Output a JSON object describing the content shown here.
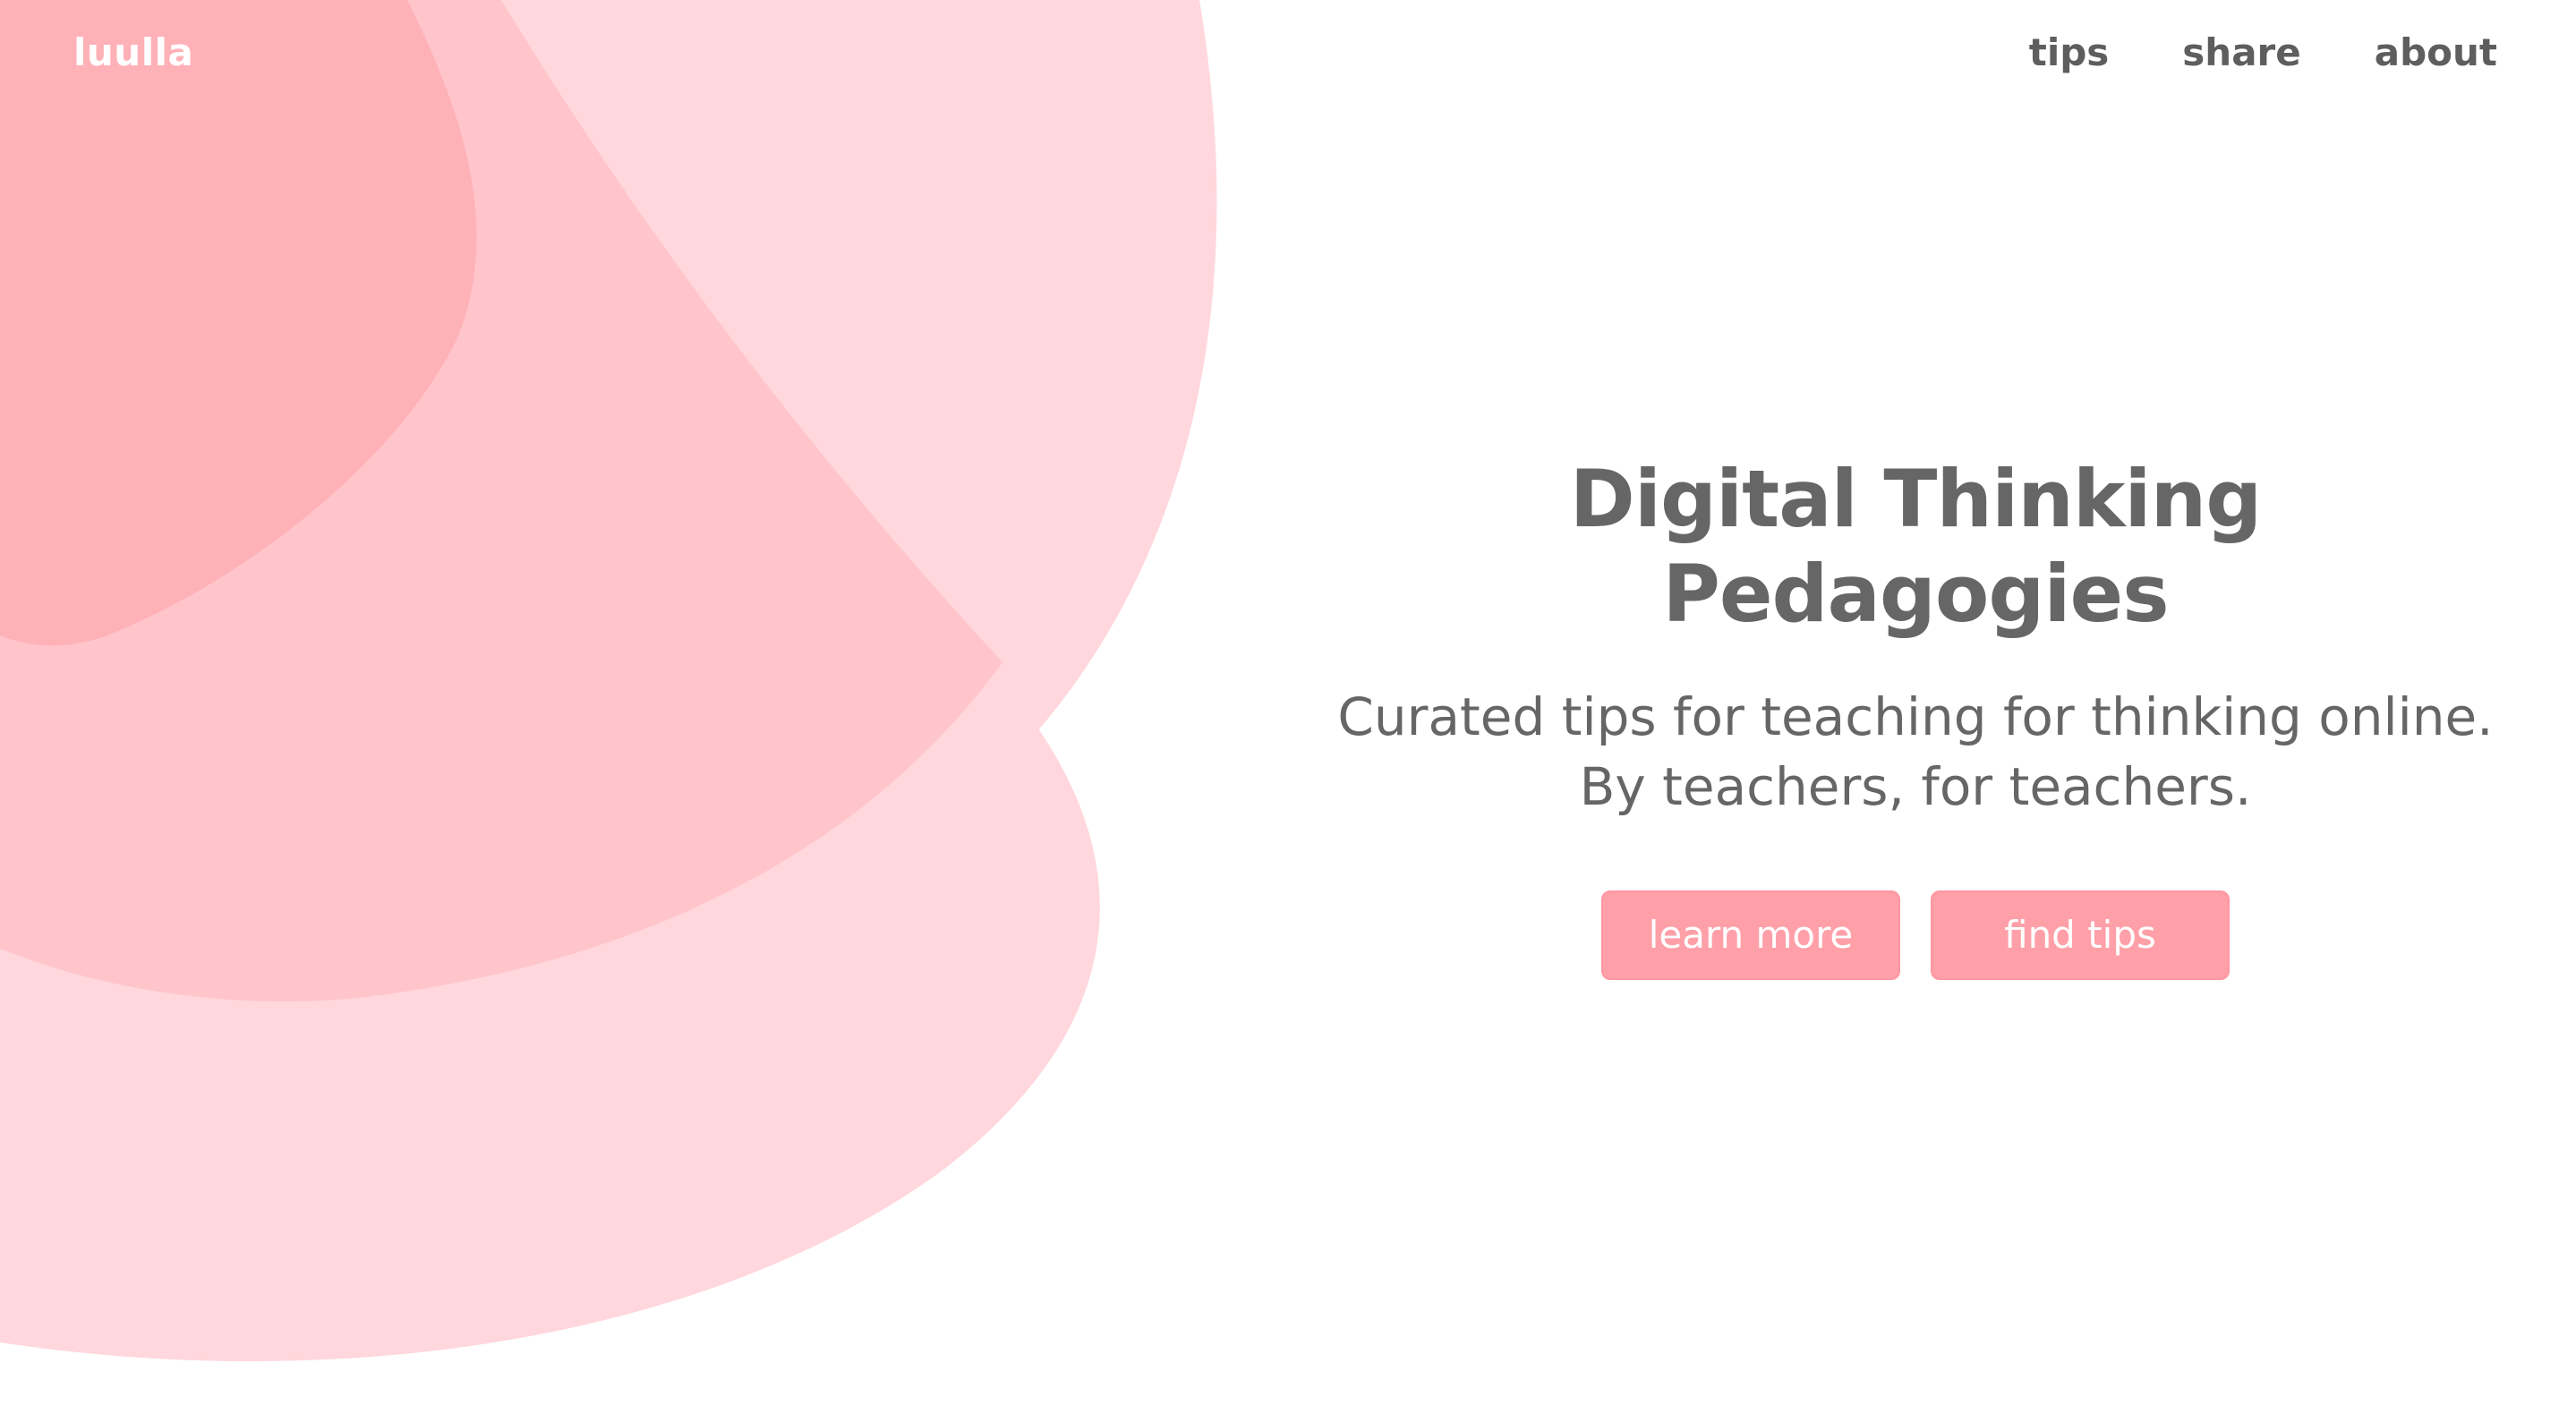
{
  "brand": {
    "name": "luulla"
  },
  "nav": {
    "items": [
      {
        "label": "tips"
      },
      {
        "label": "share"
      },
      {
        "label": "about"
      }
    ]
  },
  "hero": {
    "title": "Digital Thinking Pedagogies",
    "subtitle_line1": "Curated tips for teaching for thinking online.",
    "subtitle_line2": "By teachers, for teachers."
  },
  "buttons": {
    "learn_more": "learn more",
    "find_tips": "find tips"
  },
  "colors": {
    "blob_light": "#ffd7dc",
    "blob_mid": "#ffc5cb",
    "blob_dark": "#ffb1b8",
    "button_bg": "#ffa0a9",
    "text_gray": "#666666"
  }
}
